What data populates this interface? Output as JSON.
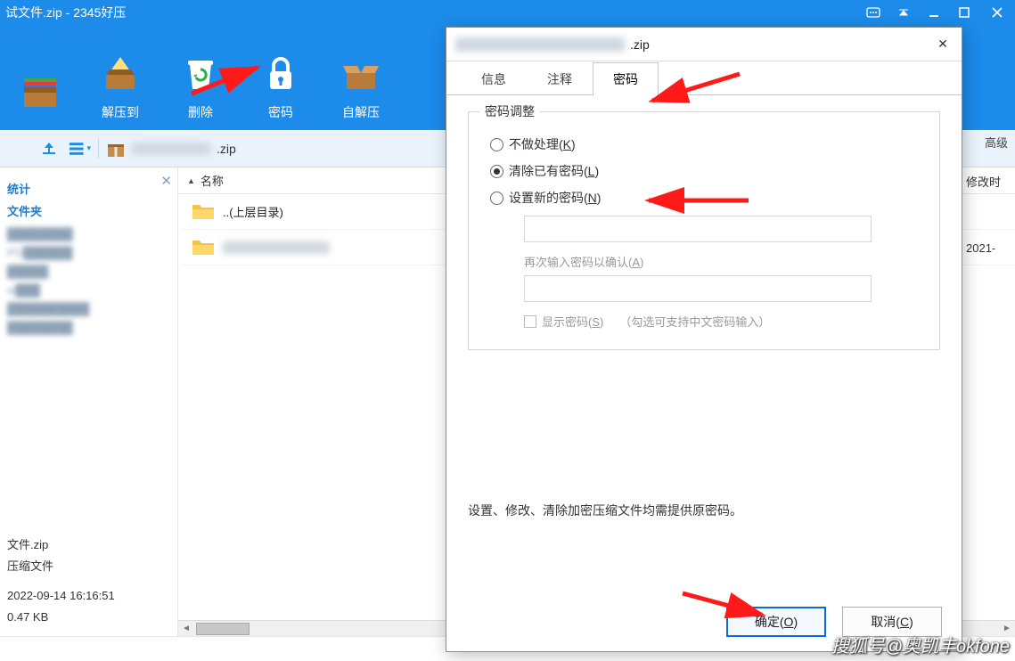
{
  "titlebar": {
    "title": "试文件.zip - 2345好压"
  },
  "toolbar": {
    "items": [
      "",
      "解压到",
      "删除",
      "密码",
      "自解压"
    ]
  },
  "pathbar": {
    "crumb": ".zip",
    "advanced": "高级"
  },
  "sidebar": {
    "section1": "统计",
    "section2": "文件夹",
    "info_file": "文件.zip",
    "info_type": "压缩文件",
    "info_date": "2022-09-14 16:16:51",
    "info_size": "0.47 KB"
  },
  "filepanel": {
    "col_name": "名称",
    "col_mod": "修改时",
    "up": "..(上层目录)",
    "file1": "",
    "row_date": "2021-"
  },
  "dialog": {
    "title_suffix": ".zip",
    "tabs": {
      "info": "信息",
      "comment": "注释",
      "password": "密码"
    },
    "legend": "密码调整",
    "opt_none": "不做处理(K)",
    "opt_clear": "清除已有密码(L)",
    "opt_set": "设置新的密码(N)",
    "confirm_label": "再次输入密码以确认(A)",
    "show_pw": "显示密码(S)",
    "show_hint": "（勾选可支持中文密码输入）",
    "note": "设置、修改、清除加密压缩文件均需提供原密码。",
    "ok": "确定(O)",
    "cancel": "取消(C)"
  },
  "watermark": "搜狐号@奥凯丰okfone"
}
